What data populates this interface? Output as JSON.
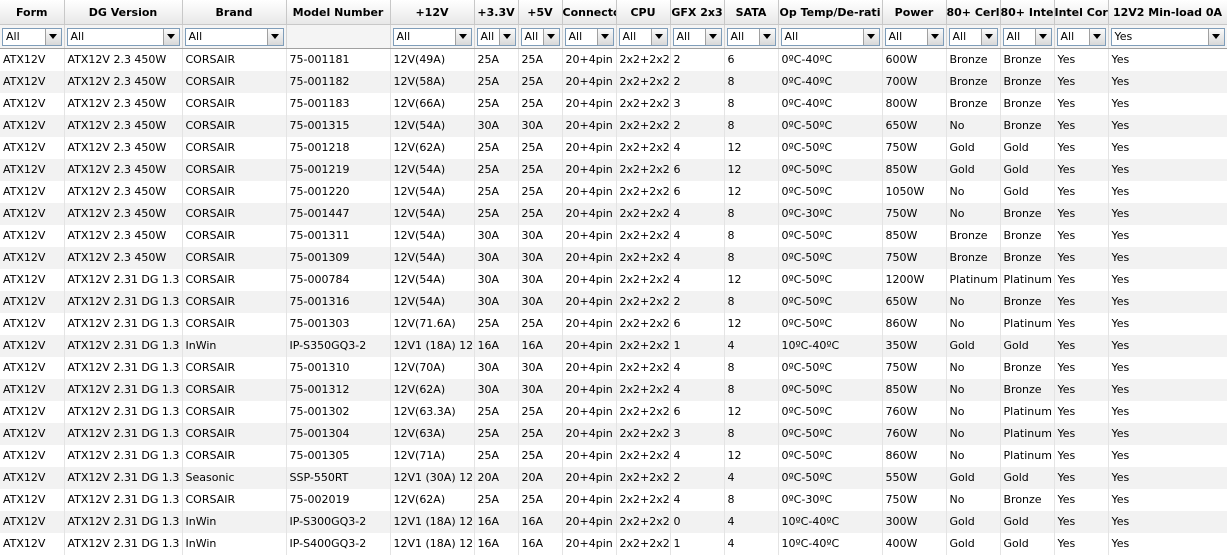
{
  "columns": [
    {
      "label": "Form",
      "filter": "All"
    },
    {
      "label": "DG Version",
      "filter": "All"
    },
    {
      "label": "Brand",
      "filter": "All"
    },
    {
      "label": "Model Number",
      "filter": ""
    },
    {
      "label": "+12V",
      "filter": "All"
    },
    {
      "label": "+3.3V",
      "filter": "All"
    },
    {
      "label": "+5V",
      "filter": "All"
    },
    {
      "label": "Connecto",
      "filter": "All"
    },
    {
      "label": "CPU",
      "filter": "All"
    },
    {
      "label": "GFX 2x3",
      "filter": "All"
    },
    {
      "label": "SATA",
      "filter": "All"
    },
    {
      "label": "Op Temp/De-rati",
      "filter": "All"
    },
    {
      "label": "Power",
      "filter": "All"
    },
    {
      "label": "80+ Cerl",
      "filter": "All"
    },
    {
      "label": "80+ Inte",
      "filter": "All"
    },
    {
      "label": "Intel Cor",
      "filter": "All"
    },
    {
      "label": "12V2 Min-load 0A",
      "filter": "Yes"
    }
  ],
  "rows": [
    [
      "ATX12V",
      "ATX12V 2.3 450W",
      "CORSAIR",
      "75-001181",
      "12V(49A)",
      "25A",
      "25A",
      "20+4pin",
      "2x2+2x2",
      "2",
      "6",
      "0ºC-40ºC",
      "600W",
      "Bronze",
      "Bronze",
      "Yes",
      "Yes"
    ],
    [
      "ATX12V",
      "ATX12V 2.3 450W",
      "CORSAIR",
      "75-001182",
      "12V(58A)",
      "25A",
      "25A",
      "20+4pin",
      "2x2+2x2",
      "2",
      "8",
      "0ºC-40ºC",
      "700W",
      "Bronze",
      "Bronze",
      "Yes",
      "Yes"
    ],
    [
      "ATX12V",
      "ATX12V 2.3 450W",
      "CORSAIR",
      "75-001183",
      "12V(66A)",
      "25A",
      "25A",
      "20+4pin",
      "2x2+2x2",
      "3",
      "8",
      "0ºC-40ºC",
      "800W",
      "Bronze",
      "Bronze",
      "Yes",
      "Yes"
    ],
    [
      "ATX12V",
      "ATX12V 2.3 450W",
      "CORSAIR",
      "75-001315",
      "12V(54A)",
      "30A",
      "30A",
      "20+4pin",
      "2x2+2x2",
      "2",
      "8",
      "0ºC-50ºC",
      "650W",
      "No",
      "Bronze",
      "Yes",
      "Yes"
    ],
    [
      "ATX12V",
      "ATX12V 2.3 450W",
      "CORSAIR",
      "75-001218",
      "12V(62A)",
      "25A",
      "25A",
      "20+4pin",
      "2x2+2x2",
      "4",
      "12",
      "0ºC-50ºC",
      "750W",
      "Gold",
      "Gold",
      "Yes",
      "Yes"
    ],
    [
      "ATX12V",
      "ATX12V 2.3 450W",
      "CORSAIR",
      "75-001219",
      "12V(54A)",
      "25A",
      "25A",
      "20+4pin",
      "2x2+2x2",
      "6",
      "12",
      "0ºC-50ºC",
      "850W",
      "Gold",
      "Gold",
      "Yes",
      "Yes"
    ],
    [
      "ATX12V",
      "ATX12V 2.3 450W",
      "CORSAIR",
      "75-001220",
      "12V(54A)",
      "25A",
      "25A",
      "20+4pin",
      "2x2+2x2",
      "6",
      "12",
      "0ºC-50ºC",
      "1050W",
      "No",
      "Gold",
      "Yes",
      "Yes"
    ],
    [
      "ATX12V",
      "ATX12V 2.3 450W",
      "CORSAIR",
      "75-001447",
      "12V(54A)",
      "25A",
      "25A",
      "20+4pin",
      "2x2+2x2",
      "4",
      "8",
      "0ºC-30ºC",
      "750W",
      "No",
      "Bronze",
      "Yes",
      "Yes"
    ],
    [
      "ATX12V",
      "ATX12V 2.3 450W",
      "CORSAIR",
      "75-001311",
      "12V(54A)",
      "30A",
      "30A",
      "20+4pin",
      "2x2+2x2",
      "4",
      "8",
      "0ºC-50ºC",
      "850W",
      "Bronze",
      "Bronze",
      "Yes",
      "Yes"
    ],
    [
      "ATX12V",
      "ATX12V 2.3 450W",
      "CORSAIR",
      "75-001309",
      "12V(54A)",
      "30A",
      "30A",
      "20+4pin",
      "2x2+2x2",
      "4",
      "8",
      "0ºC-50ºC",
      "750W",
      "Bronze",
      "Bronze",
      "Yes",
      "Yes"
    ],
    [
      "ATX12V",
      "ATX12V 2.31 DG 1.3",
      "CORSAIR",
      "75-000784",
      "12V(54A)",
      "30A",
      "30A",
      "20+4pin",
      "2x2+2x2",
      "4",
      "12",
      "0ºC-50ºC",
      "1200W",
      "Platinum",
      "Platinum",
      "Yes",
      "Yes"
    ],
    [
      "ATX12V",
      "ATX12V 2.31 DG 1.3",
      "CORSAIR",
      "75-001316",
      "12V(54A)",
      "30A",
      "30A",
      "20+4pin",
      "2x2+2x2",
      "2",
      "8",
      "0ºC-50ºC",
      "650W",
      "No",
      "Bronze",
      "Yes",
      "Yes"
    ],
    [
      "ATX12V",
      "ATX12V 2.31 DG 1.3",
      "CORSAIR",
      "75-001303",
      "12V(71.6A)",
      "25A",
      "25A",
      "20+4pin",
      "2x2+2x2",
      "6",
      "12",
      "0ºC-50ºC",
      "860W",
      "No",
      "Platinum",
      "Yes",
      "Yes"
    ],
    [
      "ATX12V",
      "ATX12V 2.31 DG 1.3",
      "InWin",
      "IP-S350GQ3-2",
      "12V1 (18A) 12",
      "16A",
      "16A",
      "20+4pin",
      "2x2+2x2",
      "1",
      "4",
      "10ºC-40ºC",
      "350W",
      "Gold",
      "Gold",
      "Yes",
      "Yes"
    ],
    [
      "ATX12V",
      "ATX12V 2.31 DG 1.3",
      "CORSAIR",
      "75-001310",
      "12V(70A)",
      "30A",
      "30A",
      "20+4pin",
      "2x2+2x2",
      "4",
      "8",
      "0ºC-50ºC",
      "750W",
      "No",
      "Bronze",
      "Yes",
      "Yes"
    ],
    [
      "ATX12V",
      "ATX12V 2.31 DG 1.3",
      "CORSAIR",
      "75-001312",
      "12V(62A)",
      "30A",
      "30A",
      "20+4pin",
      "2x2+2x2",
      "4",
      "8",
      "0ºC-50ºC",
      "850W",
      "No",
      "Bronze",
      "Yes",
      "Yes"
    ],
    [
      "ATX12V",
      "ATX12V 2.31 DG 1.3",
      "CORSAIR",
      "75-001302",
      "12V(63.3A)",
      "25A",
      "25A",
      "20+4pin",
      "2x2+2x2",
      "6",
      "12",
      "0ºC-50ºC",
      "760W",
      "No",
      "Platinum",
      "Yes",
      "Yes"
    ],
    [
      "ATX12V",
      "ATX12V 2.31 DG 1.3",
      "CORSAIR",
      "75-001304",
      "12V(63A)",
      "25A",
      "25A",
      "20+4pin",
      "2x2+2x2",
      "3",
      "8",
      "0ºC-50ºC",
      "760W",
      "No",
      "Platinum",
      "Yes",
      "Yes"
    ],
    [
      "ATX12V",
      "ATX12V 2.31 DG 1.3",
      "CORSAIR",
      "75-001305",
      "12V(71A)",
      "25A",
      "25A",
      "20+4pin",
      "2x2+2x2",
      "4",
      "12",
      "0ºC-50ºC",
      "860W",
      "No",
      "Platinum",
      "Yes",
      "Yes"
    ],
    [
      "ATX12V",
      "ATX12V 2.31 DG 1.3",
      "Seasonic",
      "SSP-550RT",
      "12V1 (30A) 12",
      "20A",
      "20A",
      "20+4pin",
      "2x2+2x2",
      "2",
      "4",
      "0ºC-50ºC",
      "550W",
      "Gold",
      "Gold",
      "Yes",
      "Yes"
    ],
    [
      "ATX12V",
      "ATX12V 2.31 DG 1.3",
      "CORSAIR",
      "75-002019",
      "12V(62A)",
      "25A",
      "25A",
      "20+4pin",
      "2x2+2x2",
      "4",
      "8",
      "0ºC-30ºC",
      "750W",
      "No",
      "Bronze",
      "Yes",
      "Yes"
    ],
    [
      "ATX12V",
      "ATX12V 2.31 DG 1.3",
      "InWin",
      "IP-S300GQ3-2",
      "12V1 (18A) 12",
      "16A",
      "16A",
      "20+4pin",
      "2x2+2x2",
      "0",
      "4",
      "10ºC-40ºC",
      "300W",
      "Gold",
      "Gold",
      "Yes",
      "Yes"
    ],
    [
      "ATX12V",
      "ATX12V 2.31 DG 1.3",
      "InWin",
      "IP-S400GQ3-2",
      "12V1 (18A) 12",
      "16A",
      "16A",
      "20+4pin",
      "2x2+2x2",
      "1",
      "4",
      "10ºC-40ºC",
      "400W",
      "Gold",
      "Gold",
      "Yes",
      "Yes"
    ]
  ]
}
